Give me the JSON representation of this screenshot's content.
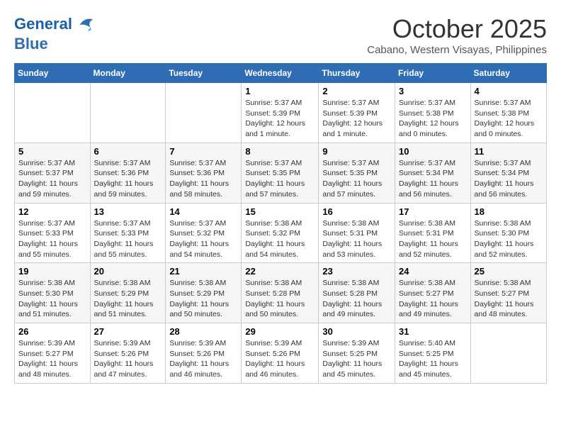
{
  "header": {
    "logo_line1": "General",
    "logo_line2": "Blue",
    "month": "October 2025",
    "location": "Cabano, Western Visayas, Philippines"
  },
  "weekdays": [
    "Sunday",
    "Monday",
    "Tuesday",
    "Wednesday",
    "Thursday",
    "Friday",
    "Saturday"
  ],
  "weeks": [
    [
      {
        "day": "",
        "info": ""
      },
      {
        "day": "",
        "info": ""
      },
      {
        "day": "",
        "info": ""
      },
      {
        "day": "1",
        "info": "Sunrise: 5:37 AM\nSunset: 5:39 PM\nDaylight: 12 hours\nand 1 minute."
      },
      {
        "day": "2",
        "info": "Sunrise: 5:37 AM\nSunset: 5:39 PM\nDaylight: 12 hours\nand 1 minute."
      },
      {
        "day": "3",
        "info": "Sunrise: 5:37 AM\nSunset: 5:38 PM\nDaylight: 12 hours\nand 0 minutes."
      },
      {
        "day": "4",
        "info": "Sunrise: 5:37 AM\nSunset: 5:38 PM\nDaylight: 12 hours\nand 0 minutes."
      }
    ],
    [
      {
        "day": "5",
        "info": "Sunrise: 5:37 AM\nSunset: 5:37 PM\nDaylight: 11 hours\nand 59 minutes."
      },
      {
        "day": "6",
        "info": "Sunrise: 5:37 AM\nSunset: 5:36 PM\nDaylight: 11 hours\nand 59 minutes."
      },
      {
        "day": "7",
        "info": "Sunrise: 5:37 AM\nSunset: 5:36 PM\nDaylight: 11 hours\nand 58 minutes."
      },
      {
        "day": "8",
        "info": "Sunrise: 5:37 AM\nSunset: 5:35 PM\nDaylight: 11 hours\nand 57 minutes."
      },
      {
        "day": "9",
        "info": "Sunrise: 5:37 AM\nSunset: 5:35 PM\nDaylight: 11 hours\nand 57 minutes."
      },
      {
        "day": "10",
        "info": "Sunrise: 5:37 AM\nSunset: 5:34 PM\nDaylight: 11 hours\nand 56 minutes."
      },
      {
        "day": "11",
        "info": "Sunrise: 5:37 AM\nSunset: 5:34 PM\nDaylight: 11 hours\nand 56 minutes."
      }
    ],
    [
      {
        "day": "12",
        "info": "Sunrise: 5:37 AM\nSunset: 5:33 PM\nDaylight: 11 hours\nand 55 minutes."
      },
      {
        "day": "13",
        "info": "Sunrise: 5:37 AM\nSunset: 5:33 PM\nDaylight: 11 hours\nand 55 minutes."
      },
      {
        "day": "14",
        "info": "Sunrise: 5:37 AM\nSunset: 5:32 PM\nDaylight: 11 hours\nand 54 minutes."
      },
      {
        "day": "15",
        "info": "Sunrise: 5:38 AM\nSunset: 5:32 PM\nDaylight: 11 hours\nand 54 minutes."
      },
      {
        "day": "16",
        "info": "Sunrise: 5:38 AM\nSunset: 5:31 PM\nDaylight: 11 hours\nand 53 minutes."
      },
      {
        "day": "17",
        "info": "Sunrise: 5:38 AM\nSunset: 5:31 PM\nDaylight: 11 hours\nand 52 minutes."
      },
      {
        "day": "18",
        "info": "Sunrise: 5:38 AM\nSunset: 5:30 PM\nDaylight: 11 hours\nand 52 minutes."
      }
    ],
    [
      {
        "day": "19",
        "info": "Sunrise: 5:38 AM\nSunset: 5:30 PM\nDaylight: 11 hours\nand 51 minutes."
      },
      {
        "day": "20",
        "info": "Sunrise: 5:38 AM\nSunset: 5:29 PM\nDaylight: 11 hours\nand 51 minutes."
      },
      {
        "day": "21",
        "info": "Sunrise: 5:38 AM\nSunset: 5:29 PM\nDaylight: 11 hours\nand 50 minutes."
      },
      {
        "day": "22",
        "info": "Sunrise: 5:38 AM\nSunset: 5:28 PM\nDaylight: 11 hours\nand 50 minutes."
      },
      {
        "day": "23",
        "info": "Sunrise: 5:38 AM\nSunset: 5:28 PM\nDaylight: 11 hours\nand 49 minutes."
      },
      {
        "day": "24",
        "info": "Sunrise: 5:38 AM\nSunset: 5:27 PM\nDaylight: 11 hours\nand 49 minutes."
      },
      {
        "day": "25",
        "info": "Sunrise: 5:38 AM\nSunset: 5:27 PM\nDaylight: 11 hours\nand 48 minutes."
      }
    ],
    [
      {
        "day": "26",
        "info": "Sunrise: 5:39 AM\nSunset: 5:27 PM\nDaylight: 11 hours\nand 48 minutes."
      },
      {
        "day": "27",
        "info": "Sunrise: 5:39 AM\nSunset: 5:26 PM\nDaylight: 11 hours\nand 47 minutes."
      },
      {
        "day": "28",
        "info": "Sunrise: 5:39 AM\nSunset: 5:26 PM\nDaylight: 11 hours\nand 46 minutes."
      },
      {
        "day": "29",
        "info": "Sunrise: 5:39 AM\nSunset: 5:26 PM\nDaylight: 11 hours\nand 46 minutes."
      },
      {
        "day": "30",
        "info": "Sunrise: 5:39 AM\nSunset: 5:25 PM\nDaylight: 11 hours\nand 45 minutes."
      },
      {
        "day": "31",
        "info": "Sunrise: 5:40 AM\nSunset: 5:25 PM\nDaylight: 11 hours\nand 45 minutes."
      },
      {
        "day": "",
        "info": ""
      }
    ]
  ]
}
